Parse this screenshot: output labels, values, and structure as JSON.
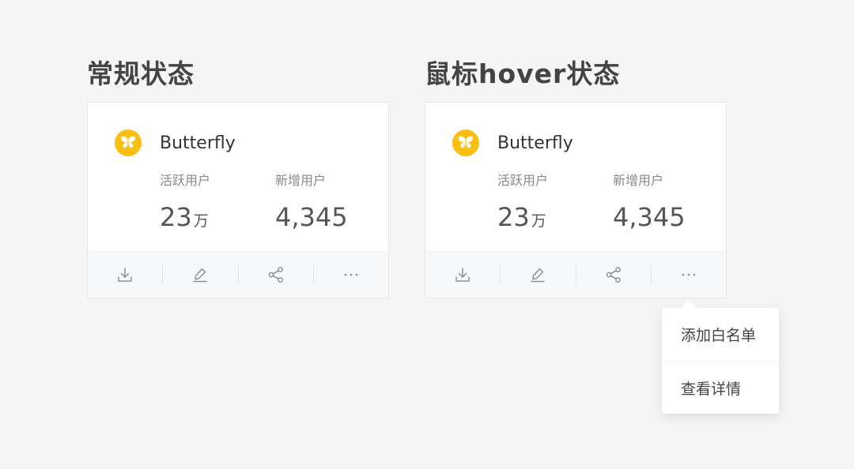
{
  "sections": [
    {
      "title": "常规状态",
      "card": {
        "brand": "Butterfly",
        "stats": [
          {
            "label": "活跃用户",
            "value": "23",
            "unit": "万"
          },
          {
            "label": "新增用户",
            "value": "4,345",
            "unit": ""
          }
        ],
        "actions": [
          {
            "icon": "download-icon"
          },
          {
            "icon": "edit-icon"
          },
          {
            "icon": "share-icon"
          },
          {
            "icon": "more-icon",
            "glyph": "···"
          }
        ]
      }
    },
    {
      "title": "鼠标hover状态",
      "card": {
        "brand": "Butterfly",
        "stats": [
          {
            "label": "活跃用户",
            "value": "23",
            "unit": "万"
          },
          {
            "label": "新增用户",
            "value": "4,345",
            "unit": ""
          }
        ],
        "actions": [
          {
            "icon": "download-icon"
          },
          {
            "icon": "edit-icon"
          },
          {
            "icon": "share-icon"
          },
          {
            "icon": "more-icon",
            "glyph": "···"
          }
        ]
      }
    }
  ],
  "dropdown": {
    "items": [
      "添加白名单",
      "查看详情"
    ]
  },
  "colors": {
    "background": "#f5f5f5",
    "logo": "#fbbf14",
    "icon": "#8a8f99"
  }
}
